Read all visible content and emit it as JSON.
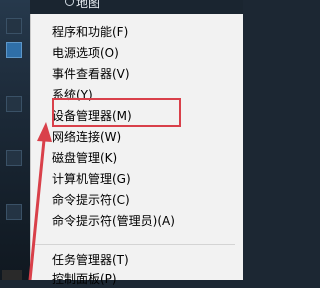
{
  "window": {
    "partial_title": "地图"
  },
  "menu": {
    "items": [
      {
        "label": "程序和功能(F)"
      },
      {
        "label": "电源选项(O)"
      },
      {
        "label": "事件查看器(V)"
      },
      {
        "label": "系统(Y)"
      },
      {
        "label": "设备管理器(M)"
      },
      {
        "label": "网络连接(W)"
      },
      {
        "label": "磁盘管理(K)"
      },
      {
        "label": "计算机管理(G)"
      },
      {
        "label": "命令提示符(C)"
      },
      {
        "label": "命令提示符(管理员)(A)"
      },
      {
        "label": "任务管理器(T)"
      },
      {
        "label": "控制面板(P)"
      }
    ],
    "highlighted_label": "设备管理器(M)"
  },
  "colors": {
    "menu_background": "#f2f2f2",
    "highlight_box": "#d9404a",
    "arrow": "#d9404a",
    "desktop": "#1c2733"
  }
}
